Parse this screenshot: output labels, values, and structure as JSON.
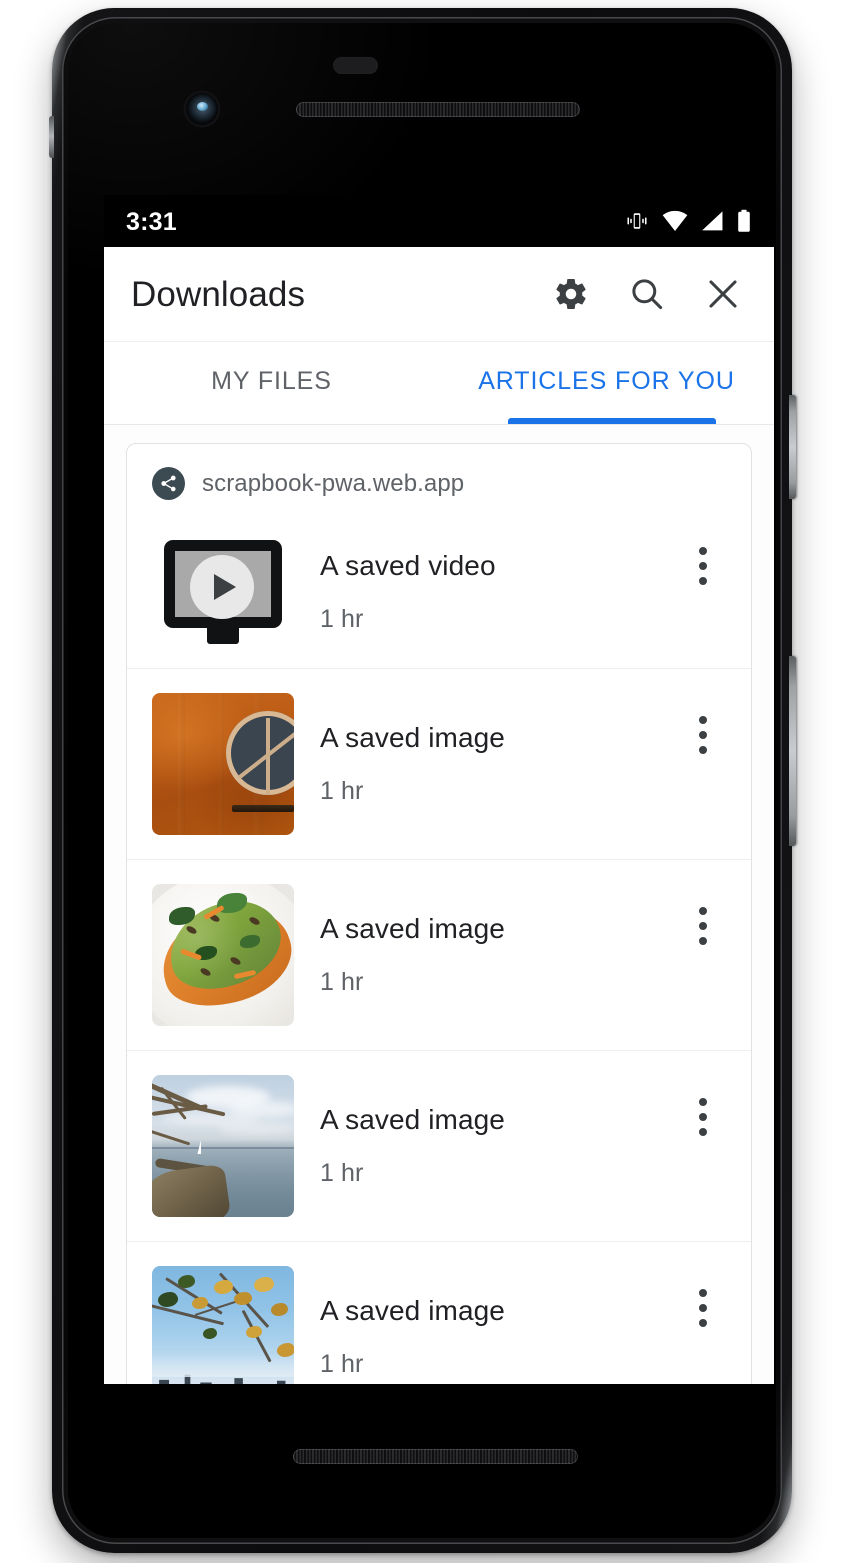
{
  "status_bar": {
    "time": "3:31",
    "icons": [
      "vibrate-icon",
      "wifi-icon",
      "cell-signal-icon",
      "battery-icon"
    ]
  },
  "app_bar": {
    "title": "Downloads",
    "actions": [
      {
        "name": "settings-button",
        "icon": "gear-icon"
      },
      {
        "name": "search-button",
        "icon": "search-icon"
      },
      {
        "name": "close-button",
        "icon": "close-icon"
      }
    ]
  },
  "tabs": {
    "items": [
      {
        "label": "MY FILES",
        "active": false
      },
      {
        "label": "ARTICLES FOR YOU",
        "active": true
      }
    ],
    "active_color": "#1a73e8",
    "inactive_color": "#5f6368"
  },
  "card": {
    "favicon_icon": "share-icon",
    "favicon_color": "#3c4a52",
    "domain": "scrapbook-pwa.web.app",
    "rows": [
      {
        "title": "A saved video",
        "subtitle": "1 hr",
        "thumb": "video-placeholder",
        "overflow_icon": "more-vert-icon"
      },
      {
        "title": "A saved image",
        "subtitle": "1 hr",
        "thumb": "orange-wall-photo",
        "overflow_icon": "more-vert-icon"
      },
      {
        "title": "A saved image",
        "subtitle": "1 hr",
        "thumb": "avocado-toast-photo",
        "overflow_icon": "more-vert-icon"
      },
      {
        "title": "A saved image",
        "subtitle": "1 hr",
        "thumb": "lake-shore-photo",
        "overflow_icon": "more-vert-icon"
      },
      {
        "title": "A saved image",
        "subtitle": "1 hr",
        "thumb": "city-autumn-photo",
        "overflow_icon": "more-vert-icon"
      }
    ]
  },
  "device": {
    "hardware": [
      "front-camera",
      "earpiece-speaker",
      "power-button",
      "volume-button",
      "bottom-speaker"
    ]
  }
}
